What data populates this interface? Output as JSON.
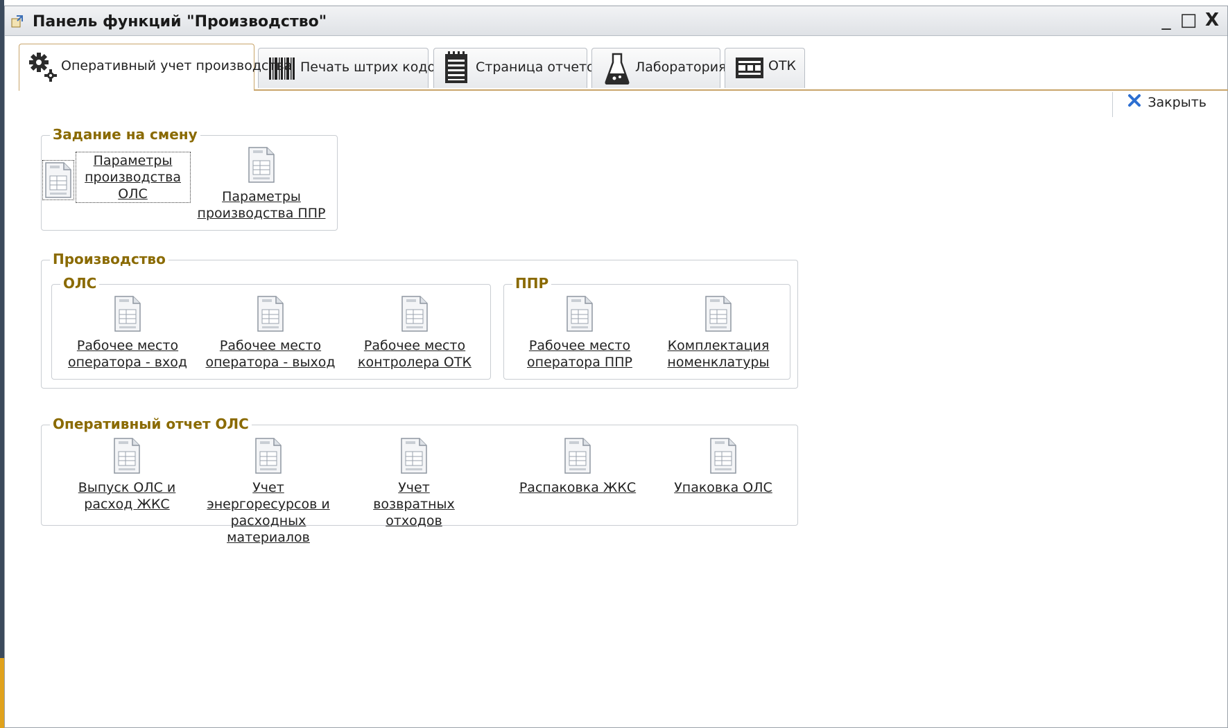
{
  "window": {
    "title": "Панель функций \"Производство\"",
    "controls": {
      "minimize": "_",
      "maximize": "□",
      "close": "X"
    }
  },
  "tabs": [
    {
      "label": "Оперативный учет производства",
      "icon": "gears-icon",
      "active": true
    },
    {
      "label": "Печать штрих кодов",
      "icon": "barcode-icon",
      "active": false
    },
    {
      "label": "Страница отчетов",
      "icon": "report-page-icon",
      "active": false
    },
    {
      "label": "Лаборатория",
      "icon": "flask-icon",
      "active": false
    },
    {
      "label": "ОТК",
      "icon": "otk-icon",
      "active": false
    }
  ],
  "toolbar": {
    "close_label": "Закрыть"
  },
  "groups": {
    "shift_task": {
      "title": "Задание на смену",
      "items": [
        {
          "label": "Параметры производства ОЛС"
        },
        {
          "label": "Параметры производства ППР"
        }
      ]
    },
    "production": {
      "title": "Производство",
      "ols": {
        "title": "ОЛС",
        "items": [
          {
            "label": "Рабочее место оператора - вход"
          },
          {
            "label": "Рабочее место оператора - выход"
          },
          {
            "label": "Рабочее место контролера ОТК"
          }
        ]
      },
      "ppr": {
        "title": "ППР",
        "items": [
          {
            "label": "Рабочее место оператора ППР"
          },
          {
            "label": "Комплектация номенклатуры"
          }
        ]
      }
    },
    "ols_report": {
      "title": "Оперативный отчет ОЛС",
      "items": [
        {
          "label": "Выпуск ОЛС и расход ЖКС"
        },
        {
          "label": "Учет энергоресурсов и расходных материалов"
        },
        {
          "label": "Учет возвратных отходов"
        },
        {
          "label": "Распаковка ЖКС"
        },
        {
          "label": "Упаковка ОЛС"
        }
      ]
    }
  },
  "colors": {
    "group_title": "#8a6a00",
    "active_tab_border": "#c8a46a",
    "close_icon": "#2d6fd1"
  }
}
